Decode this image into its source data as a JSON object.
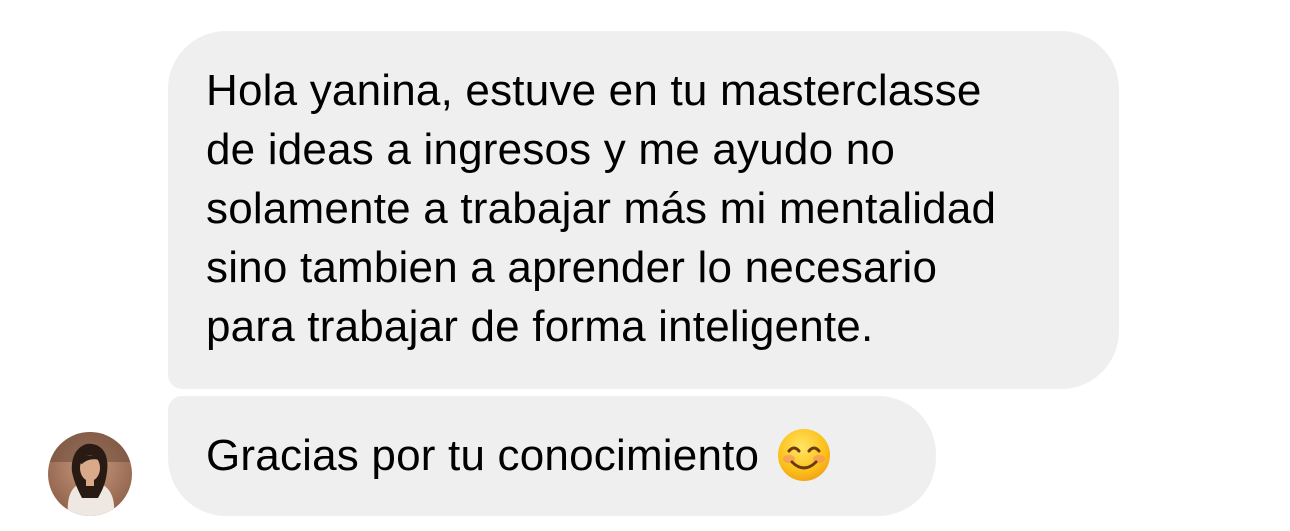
{
  "messages": [
    {
      "lines": [
        "Hola yanina, estuve en tu masterclasse",
        "de ideas a ingresos y me ayudo no",
        "solamente a trabajar más mi mentalidad",
        "sino tambien a aprender lo necesario",
        "para trabajar de forma inteligente."
      ]
    },
    {
      "text": "Gracias por tu conocimiento",
      "emoji": "smiling-face-with-smiling-eyes-icon"
    }
  ],
  "sender": {
    "avatar": "profile-photo-avatar"
  },
  "colors": {
    "bubble_background": "#efeff0",
    "text": "#000000",
    "background": "#ffffff"
  }
}
